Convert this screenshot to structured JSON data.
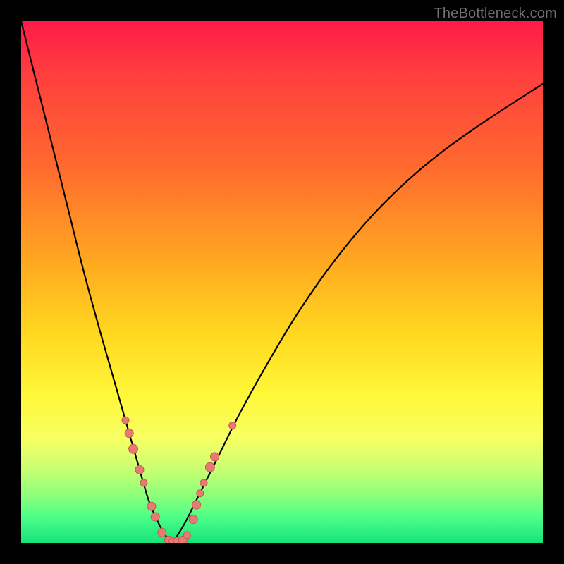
{
  "watermark": "TheBottleneck.com",
  "chart_data": {
    "type": "line",
    "title": "",
    "xlabel": "",
    "ylabel": "",
    "xlim": [
      0,
      100
    ],
    "ylim": [
      0,
      100
    ],
    "series": [
      {
        "name": "left-curve",
        "x": [
          0,
          3,
          6,
          9,
          12,
          15,
          17,
          19,
          21,
          23,
          24.5,
          26,
          27,
          28,
          29
        ],
        "y": [
          100,
          88,
          76,
          64,
          52,
          41,
          34,
          27,
          20,
          13,
          8,
          4.5,
          2.5,
          1,
          0
        ]
      },
      {
        "name": "right-curve",
        "x": [
          29,
          30,
          31.5,
          33,
          35,
          38,
          42,
          47,
          53,
          60,
          68,
          77,
          87,
          100
        ],
        "y": [
          0,
          1.5,
          4,
          7,
          11,
          17,
          25,
          34,
          44,
          54,
          63.5,
          72,
          79.5,
          88
        ]
      }
    ],
    "points": {
      "name": "sample-dots",
      "coords": [
        {
          "x": 20.0,
          "y": 23.5,
          "r": 5
        },
        {
          "x": 20.7,
          "y": 21.0,
          "r": 6
        },
        {
          "x": 21.5,
          "y": 18.0,
          "r": 6.5
        },
        {
          "x": 22.7,
          "y": 14.0,
          "r": 6
        },
        {
          "x": 23.5,
          "y": 11.5,
          "r": 5
        },
        {
          "x": 25.0,
          "y": 7.0,
          "r": 6
        },
        {
          "x": 25.7,
          "y": 5.0,
          "r": 6
        },
        {
          "x": 27.0,
          "y": 2.0,
          "r": 6
        },
        {
          "x": 28.3,
          "y": 0.5,
          "r": 6
        },
        {
          "x": 29.0,
          "y": 0.3,
          "r": 5
        },
        {
          "x": 30.0,
          "y": 0.3,
          "r": 6
        },
        {
          "x": 31.0,
          "y": 0.5,
          "r": 6
        },
        {
          "x": 31.8,
          "y": 1.5,
          "r": 5
        },
        {
          "x": 33.0,
          "y": 4.5,
          "r": 6
        },
        {
          "x": 33.6,
          "y": 7.3,
          "r": 6
        },
        {
          "x": 34.3,
          "y": 9.5,
          "r": 5
        },
        {
          "x": 35.0,
          "y": 11.5,
          "r": 5
        },
        {
          "x": 36.2,
          "y": 14.5,
          "r": 6.5
        },
        {
          "x": 37.1,
          "y": 16.5,
          "r": 6
        },
        {
          "x": 40.5,
          "y": 22.5,
          "r": 5
        }
      ]
    }
  }
}
